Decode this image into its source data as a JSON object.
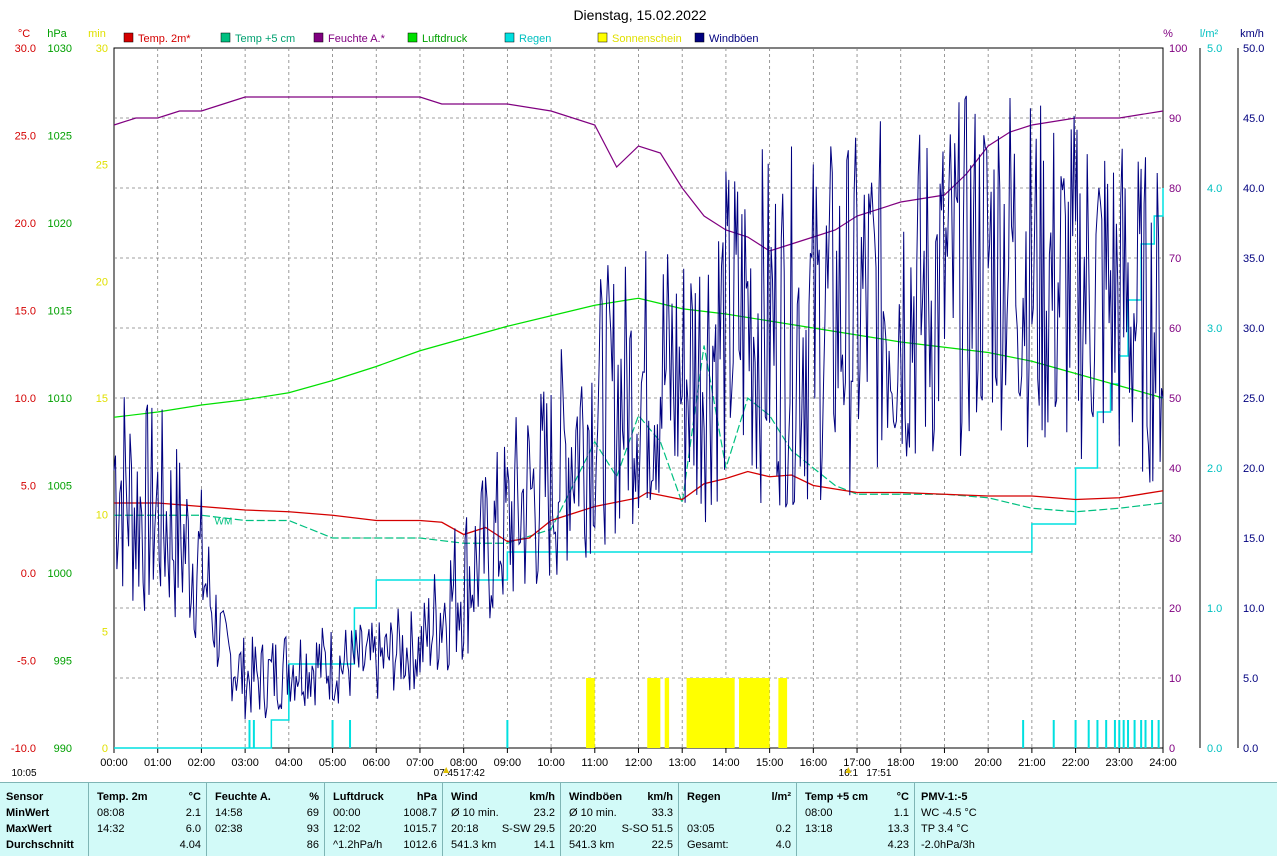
{
  "title": "Dienstag, 15.02.2022",
  "colors": {
    "temp2m": "#d40000",
    "temp5cm": "#00c080",
    "humidity": "#800080",
    "pressure": "#00e000",
    "rain": "#00e0e0",
    "sunshine": "#ffff00",
    "gusts": "#00007f",
    "grid": "#808080",
    "summary_bg": "#d2faf8"
  },
  "chart_data": {
    "type": "line",
    "title": "Dienstag, 15.02.2022",
    "legend_position": "top",
    "grid": true,
    "x_ticks": [
      "00:00",
      "01:00",
      "02:00",
      "03:00",
      "04:00",
      "05:00",
      "06:00",
      "07:00",
      "08:00",
      "09:00",
      "10:00",
      "11:00",
      "12:00",
      "13:00",
      "14:00",
      "15:00",
      "16:00",
      "17:00",
      "18:00",
      "19:00",
      "20:00",
      "21:00",
      "22:00",
      "23:00",
      "24:00"
    ],
    "axes": {
      "temp": {
        "unit": "°C",
        "range": [
          -10,
          30
        ],
        "ticks": [
          "30.0",
          "25.0",
          "20.0",
          "15.0",
          "10.0",
          "5.0",
          "0.0",
          "-5.0",
          "-10.0"
        ]
      },
      "pressure": {
        "unit": "hPa",
        "range": [
          990,
          1030
        ],
        "ticks": [
          "1030",
          "1025",
          "1020",
          "1015",
          "1010",
          "1005",
          "1000",
          "995",
          "990"
        ]
      },
      "sunshine": {
        "unit": "min",
        "range": [
          0,
          30
        ],
        "ticks": [
          "30",
          "25",
          "20",
          "15",
          "10",
          "5",
          "0"
        ]
      },
      "humidity": {
        "unit": "%",
        "range": [
          0,
          100
        ],
        "ticks": [
          "100",
          "90",
          "80",
          "70",
          "60",
          "50",
          "40",
          "30",
          "20",
          "10",
          "0"
        ]
      },
      "rain": {
        "unit": "l/m²",
        "range": [
          0,
          5
        ],
        "ticks": [
          "5.0",
          "4.0",
          "3.0",
          "2.0",
          "1.0",
          "0.0"
        ]
      },
      "wind": {
        "unit": "km/h",
        "range": [
          0,
          50
        ],
        "ticks": [
          "50.0",
          "45.0",
          "40.0",
          "35.0",
          "30.0",
          "25.0",
          "20.0",
          "15.0",
          "10.0",
          "5.0",
          "0.0"
        ]
      }
    },
    "series": [
      {
        "name": "Temp. 2m*",
        "axis": "temp",
        "x": [
          0,
          1,
          2,
          3,
          4,
          5,
          6,
          7,
          7.5,
          8,
          8.5,
          9,
          9.5,
          10,
          11,
          12,
          12.2,
          13,
          13.5,
          14,
          14.5,
          15,
          15.5,
          16,
          17,
          18,
          19,
          20,
          21,
          22,
          23,
          24
        ],
        "y": [
          4.0,
          4.0,
          3.8,
          3.6,
          3.5,
          3.3,
          3.0,
          3.0,
          2.9,
          2.2,
          2.6,
          1.8,
          2.0,
          3.0,
          3.8,
          4.3,
          4.6,
          4.2,
          5.1,
          5.4,
          5.8,
          5.5,
          5.6,
          5.0,
          4.6,
          4.6,
          4.5,
          4.4,
          4.4,
          4.2,
          4.3,
          4.7
        ]
      },
      {
        "name": "Temp +5 cm",
        "axis": "temp",
        "x": [
          0,
          2,
          3,
          4,
          5,
          6,
          7,
          8,
          9,
          10,
          11,
          11.5,
          12,
          12.5,
          13,
          13.5,
          14,
          14.5,
          15,
          15.5,
          16,
          16.5,
          17,
          18,
          19,
          20,
          21,
          22,
          23,
          24
        ],
        "y": [
          3.3,
          3.3,
          3.0,
          3.0,
          2.0,
          2.0,
          2.0,
          1.7,
          1.7,
          2.5,
          7.5,
          5.5,
          9.0,
          7.5,
          4.0,
          13.0,
          6.0,
          10.0,
          9.0,
          7.0,
          6.0,
          5.0,
          4.5,
          4.5,
          4.5,
          4.3,
          3.7,
          3.5,
          3.7,
          4.0
        ]
      },
      {
        "name": "Feuchte A.*",
        "axis": "humidity",
        "x": [
          0,
          0.5,
          1,
          1.5,
          2,
          2.5,
          3,
          4,
          5,
          6,
          7,
          7.5,
          8,
          9,
          10,
          11,
          11.5,
          12,
          12.5,
          13,
          13.5,
          14,
          14.5,
          15,
          15.5,
          16,
          16.5,
          17,
          18,
          19,
          19.5,
          20,
          20.5,
          21,
          22,
          23,
          24
        ],
        "y": [
          89,
          90,
          90,
          91,
          91,
          92,
          93,
          93,
          93,
          93,
          93,
          92,
          92,
          92,
          91,
          89,
          83,
          86,
          85,
          80,
          76,
          74,
          73,
          71,
          72,
          73,
          74,
          76,
          78,
          79,
          82,
          86,
          88,
          89,
          90,
          90,
          91
        ]
      },
      {
        "name": "Luftdruck",
        "axis": "pressure",
        "x": [
          0,
          1,
          2,
          3,
          4,
          5,
          6,
          7,
          8,
          9,
          10,
          11,
          12,
          12.5,
          13,
          14,
          15,
          16,
          17,
          18,
          19,
          20,
          21,
          22,
          23,
          24
        ],
        "y": [
          1008.9,
          1009.2,
          1009.6,
          1009.9,
          1010.3,
          1011.0,
          1011.8,
          1012.7,
          1013.4,
          1014.1,
          1014.7,
          1015.3,
          1015.7,
          1015.4,
          1015.1,
          1014.8,
          1014.4,
          1014.0,
          1013.6,
          1013.2,
          1012.9,
          1012.6,
          1012.1,
          1011.4,
          1010.7,
          1010.0
        ]
      },
      {
        "name": "Regen",
        "axis": "rain",
        "x": [
          0,
          3.05,
          3.6,
          4,
          5,
          5.5,
          6,
          7.5,
          8.5,
          9,
          10,
          11,
          12,
          13,
          14,
          15,
          16,
          17,
          18,
          19,
          20,
          20.8,
          21,
          21.5,
          22,
          22.5,
          22.8,
          23,
          23.2,
          23.5,
          23.8,
          24
        ],
        "y": [
          0,
          0,
          0.2,
          0.6,
          0.6,
          1.0,
          1.2,
          1.2,
          1.2,
          1.4,
          1.4,
          1.4,
          1.4,
          1.4,
          1.4,
          1.4,
          1.4,
          1.4,
          1.4,
          1.4,
          1.4,
          1.4,
          1.6,
          1.6,
          2.0,
          2.4,
          2.6,
          2.8,
          3.2,
          3.6,
          3.8,
          4.0
        ]
      },
      {
        "name": "Sonnenschein",
        "axis": "sunshine",
        "bars": [
          [
            10.8,
            11.0
          ],
          [
            12.2,
            12.5
          ],
          [
            12.6,
            12.7
          ],
          [
            13.1,
            14.2
          ],
          [
            14.3,
            15.0
          ],
          [
            15.2,
            15.4
          ]
        ],
        "value": 3
      },
      {
        "name": "Windböen",
        "axis": "wind",
        "x": [
          0,
          0.5,
          1,
          1.5,
          2,
          2.5,
          3,
          3.5,
          4,
          4.5,
          5,
          5.5,
          6,
          6.5,
          7,
          7.5,
          8,
          8.5,
          9,
          9.5,
          10,
          10.5,
          11,
          11.5,
          12,
          12.5,
          13,
          13.5,
          14,
          14.5,
          15,
          15.5,
          16,
          16.5,
          17,
          17.5,
          18,
          18.5,
          19,
          19.5,
          20,
          20.5,
          21,
          21.5,
          22,
          22.5,
          23,
          23.5,
          24
        ],
        "y": [
          20,
          17,
          17,
          15,
          13,
          7,
          5,
          5,
          6,
          6,
          6,
          6,
          6,
          7,
          7,
          10,
          12,
          14,
          16,
          18,
          19,
          22,
          24,
          25,
          26,
          27,
          26,
          28,
          30,
          31,
          30,
          30,
          30,
          31,
          31,
          32,
          32,
          32,
          33,
          34,
          35,
          36,
          34,
          33,
          33,
          33,
          32,
          31,
          30
        ],
        "noise": [
          9,
          8,
          8,
          7,
          6,
          3,
          3,
          3,
          3,
          3,
          3,
          3,
          3,
          3,
          3,
          5,
          6,
          6,
          7,
          8,
          8,
          9,
          10,
          10,
          10,
          11,
          11,
          12,
          12,
          13,
          13,
          13,
          13,
          13,
          13,
          13,
          13,
          13,
          13,
          13,
          13,
          13,
          13,
          13,
          13,
          13,
          13,
          12,
          12
        ]
      }
    ],
    "legend": [
      {
        "label": "Temp. 2m*",
        "color": "#d40000",
        "text_color": "#d40000"
      },
      {
        "label": "Temp +5 cm",
        "color": "#00c080",
        "text_color": "#00a070"
      },
      {
        "label": "Feuchte A.*",
        "color": "#800080",
        "text_color": "#800080"
      },
      {
        "label": "Luftdruck",
        "color": "#00e000",
        "text_color": "#00a000"
      },
      {
        "label": "Regen",
        "color": "#00e0e0",
        "text_color": "#00c0c0"
      },
      {
        "label": "Sonnenschein",
        "color": "#ffff00",
        "text_color": "#e0e000"
      },
      {
        "label": "Windböen",
        "color": "#00007f",
        "text_color": "#00007f"
      }
    ],
    "x_notes": [
      {
        "at": 7.6,
        "text": "07:45",
        "color": "#000000"
      },
      {
        "at": 8.2,
        "text": "17:42",
        "color": "#000000"
      },
      {
        "at": 16.8,
        "text": "16:1",
        "color": "#000000"
      },
      {
        "at": 17.5,
        "text": "17:51",
        "color": "#000000"
      },
      {
        "at": -0.6,
        "text": "10:05",
        "color": "#000000"
      }
    ],
    "wm_label": "WM"
  },
  "summary": {
    "columns": [
      {
        "header": [
          "Sensor"
        ],
        "rows": [
          [
            "MinWert"
          ],
          [
            "MaxWert"
          ],
          [
            "Durchschnitt"
          ]
        ]
      },
      {
        "header": [
          "Temp. 2m",
          "°C"
        ],
        "rows": [
          [
            "08:08",
            "2.1"
          ],
          [
            "14:32",
            "6.0"
          ],
          [
            "",
            "4.04"
          ]
        ]
      },
      {
        "header": [
          "Feuchte A.",
          "%"
        ],
        "rows": [
          [
            "14:58",
            "69"
          ],
          [
            "02:38",
            "93"
          ],
          [
            "",
            "86"
          ]
        ]
      },
      {
        "header": [
          "Luftdruck",
          "hPa"
        ],
        "rows": [
          [
            "00:00",
            "1008.7"
          ],
          [
            "12:02",
            "1015.7"
          ],
          [
            "^1.2hPa/h",
            "1012.6"
          ]
        ]
      },
      {
        "header": [
          "Wind",
          "km/h"
        ],
        "rows": [
          [
            "Ø 10 min.",
            "23.2"
          ],
          [
            "20:18",
            "S-SW 29.5"
          ],
          [
            "541.3 km",
            "14.1"
          ]
        ]
      },
      {
        "header": [
          "Windböen",
          "km/h"
        ],
        "rows": [
          [
            "Ø 10 min.",
            "33.3"
          ],
          [
            "20:20",
            "S-SO 51.5"
          ],
          [
            "541.3 km",
            "22.5"
          ]
        ]
      },
      {
        "header": [
          "Regen",
          "l/m²"
        ],
        "rows": [
          [
            "",
            ""
          ],
          [
            "03:05",
            "0.2"
          ],
          [
            "Gesamt:",
            "4.0"
          ]
        ]
      },
      {
        "header": [
          "Temp +5 cm",
          "°C"
        ],
        "rows": [
          [
            "08:00",
            "1.1"
          ],
          [
            "13:18",
            "13.3"
          ],
          [
            "",
            "4.23"
          ]
        ]
      },
      {
        "header": [
          "PMV-1:-5"
        ],
        "rows": [
          [
            "WC -4.5 °C"
          ],
          [
            "TP 3.4 °C"
          ],
          [
            "-2.0hPa/3h"
          ]
        ]
      }
    ]
  }
}
